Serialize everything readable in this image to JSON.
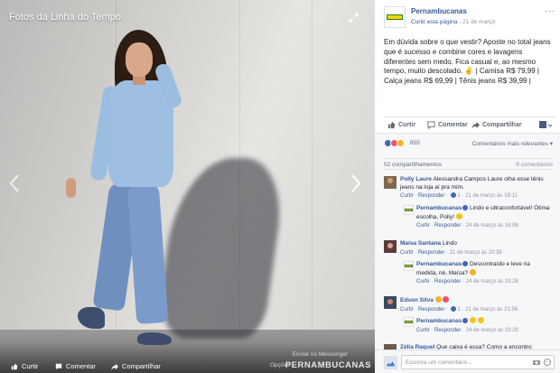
{
  "photo": {
    "album_title": "Fotos da Linha do Tempo",
    "footer": {
      "like_label": "Curtir",
      "comment_label": "Comentar",
      "share_label": "Compartilhar",
      "options_label": "Opções",
      "messenger_label": "Enviar no Messenger"
    },
    "watermark": "PERNAMBUCANAS"
  },
  "post": {
    "page_name": "Pernambucanas",
    "follow_link": "Curtir esta página",
    "date": "21 de março",
    "text": "Em dúvida sobre o que vestir? Aposte no total jeans que é sucesso e combine cores e lavagens diferentes sem medo. Fica casual e, ao mesmo tempo, muito descolado. ✌ | Camisa R$ 79,99 | Calça jeans R$ 69,99 | Tênis jeans R$ 39,99 |",
    "actions": {
      "like": "Curtir",
      "comment": "Comentar",
      "share": "Compartilhar"
    },
    "reactions_count": "855",
    "relevance_label": "Comentários mais relevantes",
    "shares": "52 compartilhamentos",
    "comments_count": "9 comentários"
  },
  "comments": [
    {
      "name": "Polly Laure",
      "text": "Alessandra Campos Laure olha esse tênis jeans na loja aí pra mim.",
      "like": "Curtir",
      "reply": "Responder",
      "likes": "1",
      "time": "21 de março às 18:11",
      "reply_item": {
        "name": "Pernambucanas",
        "text": "Lindo e ultraconfortável! Ótima escolha, Polly!",
        "like": "Curtir",
        "reply": "Responder",
        "time": "24 de março às 16:08"
      }
    },
    {
      "name": "Maísa Santana",
      "text": "Lindo",
      "like": "Curtir",
      "reply": "Responder",
      "time": "21 de março às 20:39",
      "reply_item": {
        "name": "Pernambucanas",
        "text": "Descontraído e leve na medida, né, Maísa?",
        "like": "Curtir",
        "reply": "Responder",
        "time": "24 de março às 19:28"
      }
    },
    {
      "name": "Edson Silva",
      "text": "",
      "like": "Curtir",
      "reply": "Responder",
      "likes": "1",
      "time": "21 de março às 21:56",
      "reply_item": {
        "name": "Pernambucanas",
        "text": "",
        "like": "Curtir",
        "reply": "Responder",
        "time": "24 de março às 19:29"
      }
    },
    {
      "name": "Zélia Raquel",
      "text": "Que caixa é essa? Como a encontro"
    }
  ],
  "composer": {
    "placeholder": "Escreva um comentário..."
  },
  "colors": {
    "link_blue": "#365899",
    "brand_yellow": "#f2d600",
    "brand_green": "#2d7a2d",
    "verified_blue": "#4267b2"
  },
  "icons": [
    "expand-icon",
    "chevron-left-icon",
    "chevron-right-icon",
    "like-icon",
    "comment-icon",
    "share-icon",
    "verified-icon",
    "heart-icon",
    "camera-icon",
    "emoji-icon"
  ]
}
